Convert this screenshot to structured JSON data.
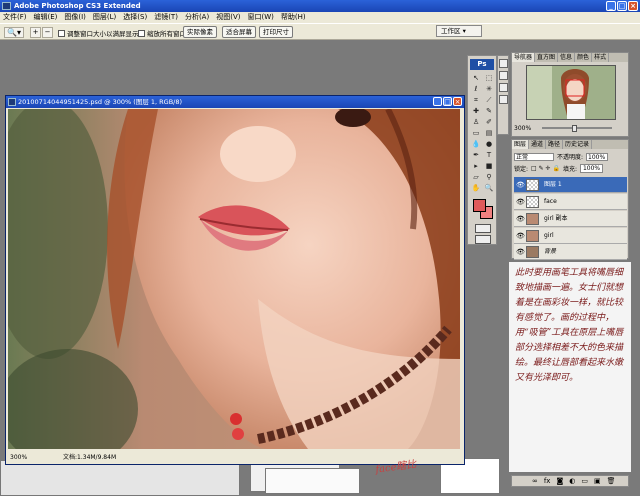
{
  "app": {
    "title": "Adobe Photoshop CS3 Extended"
  },
  "menu": [
    "文件(F)",
    "编辑(E)",
    "图像(I)",
    "图层(L)",
    "选择(S)",
    "滤镜(T)",
    "分析(A)",
    "视图(V)",
    "窗口(W)",
    "帮助(H)"
  ],
  "options": {
    "resize_window": "调整窗口大小以满屏显示",
    "zoom_all": "缩放所有窗口",
    "actual_pixels": "实际像素",
    "fit_screen": "适合屏幕",
    "print_size": "打印尺寸",
    "workspace": "工作区 ▾"
  },
  "document": {
    "title": "20100714044951425.psd @ 300% (图层 1, RGB/8)",
    "zoom": "300%",
    "status": "文档:1.34M/9.84M"
  },
  "navigator": {
    "tabs": [
      "导航器",
      "直方图",
      "信息",
      "颜色",
      "样式"
    ],
    "zoom": "300%"
  },
  "layers_panel": {
    "tabs": [
      "图层",
      "通道",
      "路径",
      "历史记录"
    ],
    "blend_mode": "正常",
    "opacity_label": "不透明度:",
    "opacity": "100%",
    "lock_label": "锁定:",
    "fill_label": "填充:",
    "fill": "100%",
    "layers": [
      {
        "name": "图层 1",
        "active": true
      },
      {
        "name": "face",
        "active": false
      },
      {
        "name": "girl 副本",
        "active": false
      },
      {
        "name": "girl",
        "active": false
      },
      {
        "name": "背景",
        "active": false
      }
    ]
  },
  "note": "此时要用画笔工具将嘴唇细致地描画一遍。女士们就想着是在画彩妆一样，就比较有感觉了。画的过程中，用“吸管”工具在原层上嘴唇部分选择相差不大的色来描绘。最终让唇部看起来水嫩又有光泽即可。",
  "signature": "face瞎比"
}
